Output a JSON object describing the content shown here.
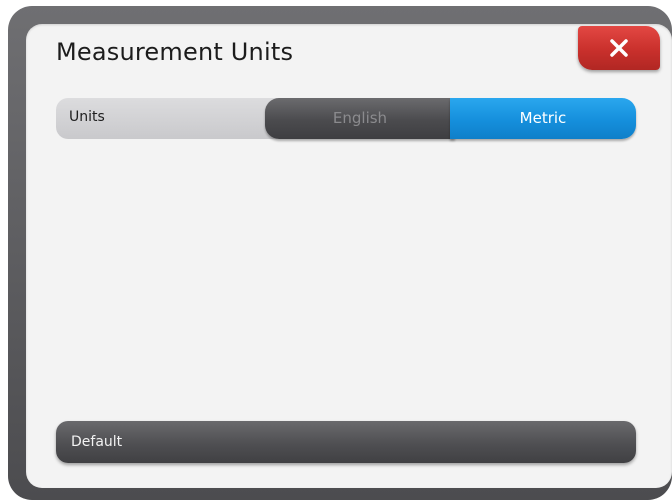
{
  "dialog": {
    "title": "Measurement Units",
    "close_icon": "close-icon",
    "close_color": "#c9302c"
  },
  "units_setting": {
    "label": "Units",
    "options": [
      {
        "label": "English",
        "selected": false
      },
      {
        "label": "Metric",
        "selected": true
      }
    ],
    "selected_color": "#158fdc"
  },
  "footer": {
    "default_label": "Default"
  }
}
